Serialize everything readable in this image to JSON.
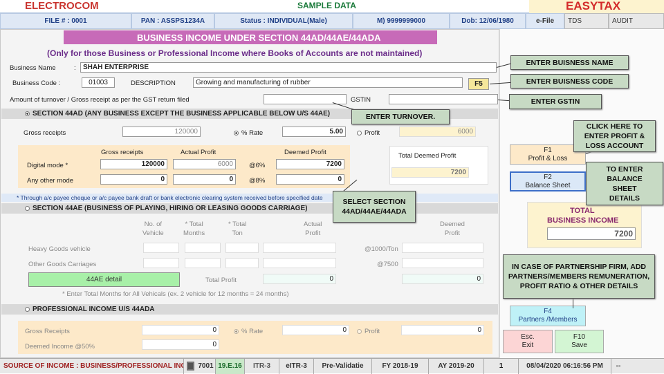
{
  "header": {
    "left_logo": "ELECTROCOM",
    "center_title": "SAMPLE DATA",
    "right_logo": "EASYTAX"
  },
  "infobar": {
    "file": "FILE # : 0001",
    "pan": "PAN : ASSPS1234A",
    "status": "Status : INDIVIDUAL(Male)",
    "mobile": "M) 9999999000",
    "dob": "Dob: 12/06/1980",
    "efile": "e-File",
    "tds": "TDS",
    "audit": "AUDIT"
  },
  "form": {
    "title": "BUSINESS INCOME UNDER SECTION 44AD/44AE/44ADA",
    "subtitle": "(Only for those Business or Professional Income where Books of Accounts are not maintained)",
    "business_name_label": "Business Name",
    "business_name_colon": ":",
    "business_name": "SHAH ENTERPRISE",
    "business_code_label": "Business Code :",
    "business_code": "01003",
    "description_label": "DESCRIPTION",
    "description": "Growing and manufacturing of rubber",
    "f5": "F5",
    "turnover_label": "Amount of turnover / Gross receipt as per the GST return filed",
    "gstin_label": "GSTIN"
  },
  "sec44ad": {
    "title": "SECTION 44AD (ANY BUSINESS EXCEPT THE BUSINESS APPLICABLE BELOW U/S 44AE)",
    "gross_receipts_label": "Gross receipts",
    "gross_receipts": "120000",
    "rate_label": "% Rate",
    "rate": "5.00",
    "profit_label": "Profit",
    "profit": "6000",
    "col_gross": "Gross receipts",
    "col_actual": "Actual Profit",
    "col_deemed": "Deemed Profit",
    "digital_label": "Digital mode *",
    "digital_gross": "120000",
    "digital_actual": "6000",
    "digital_rate": "@6%",
    "digital_deemed": "7200",
    "other_label": "Any other mode",
    "other_gross": "0",
    "other_actual": "0",
    "other_rate": "@8%",
    "other_deemed": "0",
    "total_deemed_label": "Total Deemed Profit",
    "total_deemed": "7200",
    "note": "* Through a/c payee cheque or a/c payee bank draft or bank electronic clearing system received before specified date"
  },
  "sec44ae": {
    "title": "SECTION 44AE (BUSINESS OF PLAYING, HIRING OR LEASING GOODS CARRIAGE)",
    "col_no": "No. of",
    "col_no2": "Vehicle",
    "col_months": "* Total",
    "col_months2": "Months",
    "col_ton": "* Total",
    "col_ton2": "Ton",
    "col_actual": "Actual",
    "col_actual2": "Profit",
    "col_deemed": "Deemed",
    "col_deemed2": "Profit",
    "heavy_label": "Heavy Goods vehicle",
    "heavy_rate": "@1000/Ton",
    "other_label": "Other Goods Carriages",
    "other_rate": "@7500",
    "detail_btn": "44AE detail",
    "total_label": "Total Profit",
    "total_actual": "0",
    "total_deemed": "0",
    "note": "* Enter Total Months for All Vehicals (ex. 2 vehicle for 12 months = 24 months)"
  },
  "sec44ada": {
    "title": "PROFESSIONAL INCOME U/S 44ADA",
    "gross_label": "Gross Receipts",
    "gross": "0",
    "rate_label": "% Rate",
    "rate": "0",
    "profit_label": "Profit",
    "profit": "0",
    "deemed_label": "Deemed Income @50%",
    "deemed": "0"
  },
  "right": {
    "f1": "F1\nProfit & Loss",
    "f1a": "F1",
    "f1b": "Profit & Loss",
    "f2a": "F2",
    "f2b": "Balance Sheet",
    "total_label1": "TOTAL",
    "total_label2": "BUSINESS INCOME",
    "total": "7200",
    "f4a": "F4",
    "f4b": "Partners /Members",
    "esc_a": "Esc.",
    "esc_b": "Exit",
    "f10a": "F10",
    "f10b": "Save"
  },
  "callouts": {
    "name": "ENTER BUISNESS NAME",
    "code": "ENTER BUISNESS CODE",
    "gstin": "ENTER GSTIN",
    "turnover": "ENTER TURNOVER.",
    "pl": "CLICK HERE TO ENTER PROFIT & LOSS ACCOUNT",
    "bs": "TO ENTER BALANCE SHEET DETAILS",
    "section": "SELECT SECTION 44AD/44AE/44ADA",
    "partner": "IN CASE OF PARTNERSHIP FIRM, ADD PARTNERS/MEMBERS REMUNERATION, PROFIT RATIO & OTHER DETAILS"
  },
  "statusbar": {
    "source": "SOURCE OF INCOME : BUSINESS/PROFESSIONAL INCO",
    "code": "7001",
    "ver": "19.E.16",
    "itr": "ITR-3",
    "eitr": "eITR-3",
    "pre": "Pre-Validatie",
    "fy": "FY 2018-19",
    "ay": "AY 2019-20",
    "page": "1",
    "datetime": "08/04/2020 06:16:56 PM",
    "dash": "--"
  }
}
